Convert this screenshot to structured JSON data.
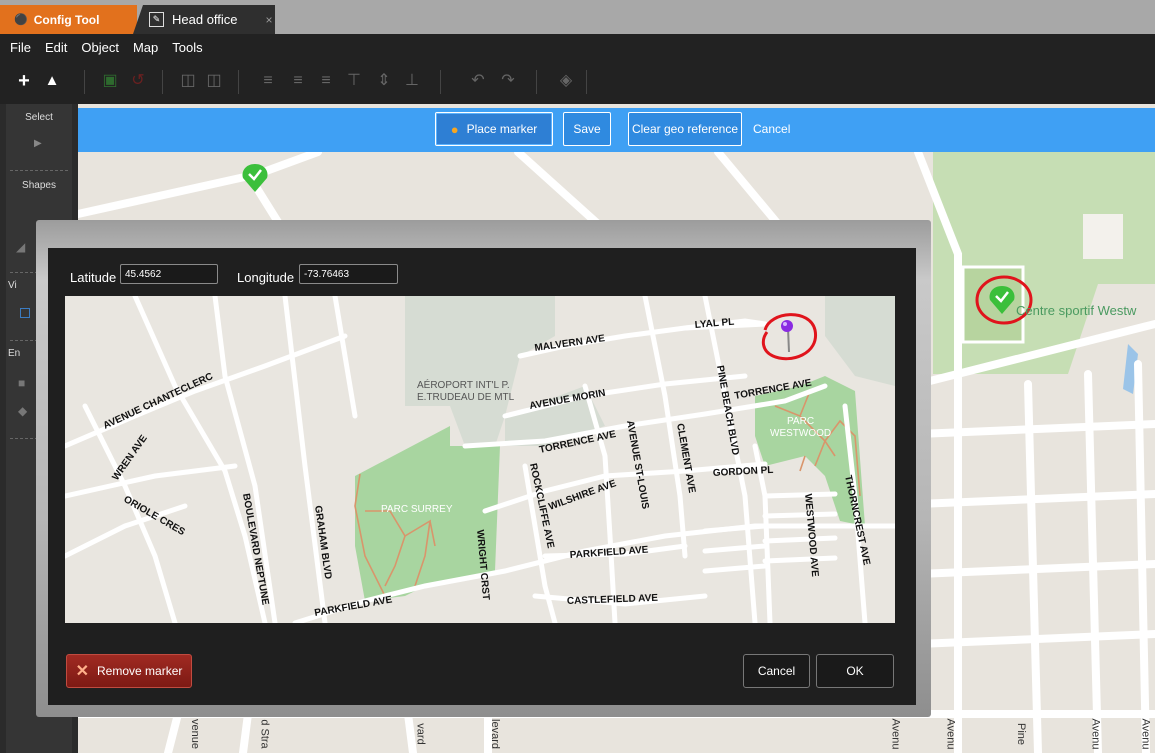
{
  "tabs": {
    "config_tool": "Config Tool",
    "head_office": "Head office",
    "close_glyph": "×"
  },
  "menu": [
    "File",
    "Edit",
    "Object",
    "Map",
    "Tools"
  ],
  "palette": {
    "select": "Select",
    "shapes": "Shapes",
    "vi": "Vi",
    "en": "En"
  },
  "geo_bar": {
    "place_marker": "Place marker",
    "save": "Save",
    "clear_geo_reference": "Clear geo reference",
    "cancel": "Cancel"
  },
  "background_map": {
    "park_label": "Centre sportif Westw",
    "bottom_streets": [
      "venue",
      "d Stra",
      "vard",
      "levard",
      "Avenu",
      "Avenu",
      "Pine",
      "Avenu",
      "Avenu"
    ]
  },
  "dialog": {
    "latitude_label": "Latitude",
    "latitude_value": "45.4562",
    "longitude_label": "Longitude",
    "longitude_value": "-73.76463",
    "remove_marker": "Remove marker",
    "cancel": "Cancel",
    "ok": "OK"
  },
  "inner_map": {
    "streets": {
      "malvern": "MALVERN AVE",
      "lyal": "LYAL PL",
      "chanteclerc": "AVENUE CHANTECLERC",
      "morin": "AVENUE MORIN",
      "torrence_right": "TORRENCE AVE",
      "torrence_mid": "TORRENCE AVE",
      "pine_beach": "PINE BEACH BLVD",
      "clement": "CLEMENT AVE",
      "st_louis": "AVENUE ST-LOUIS",
      "wilshire": "WILSHIRE AVE",
      "rockcliffe": "ROCKCLIFFE AVE",
      "gordon": "GORDON PL",
      "westwood": "WESTWOOD AVE",
      "thorncrest": "THORNCREST AVE",
      "wren": "WREN AVE",
      "oriole": "ORIOLE CRES",
      "boulevard_neptune": "BOULEVARD NEPTUNE",
      "graham": "GRAHAM BLVD",
      "wright": "WRIGHT CRST",
      "parkfield_right": "PARKFIELD AVE",
      "parkfield_left": "PARKFIELD AVE",
      "castlefield": "CASTLEFIELD AVE"
    },
    "places": {
      "airport_line1": "AÉROPORT INT'L P.",
      "airport_line2": "E.TRUDEAU DE MTL",
      "parc_surrey": "PARC SURREY",
      "parc_westwood_1": "PARC",
      "parc_westwood_2": "WESTWOOD"
    }
  },
  "colors": {
    "accent_orange": "#e2711d",
    "geo_bar_blue": "#3fa0f4",
    "remove_red": "#8e2019",
    "park_green": "#a8d5a0",
    "marker_green": "#3bbf3b",
    "pin_purple": "#8a2be2",
    "annotation_red": "#e0141c"
  }
}
